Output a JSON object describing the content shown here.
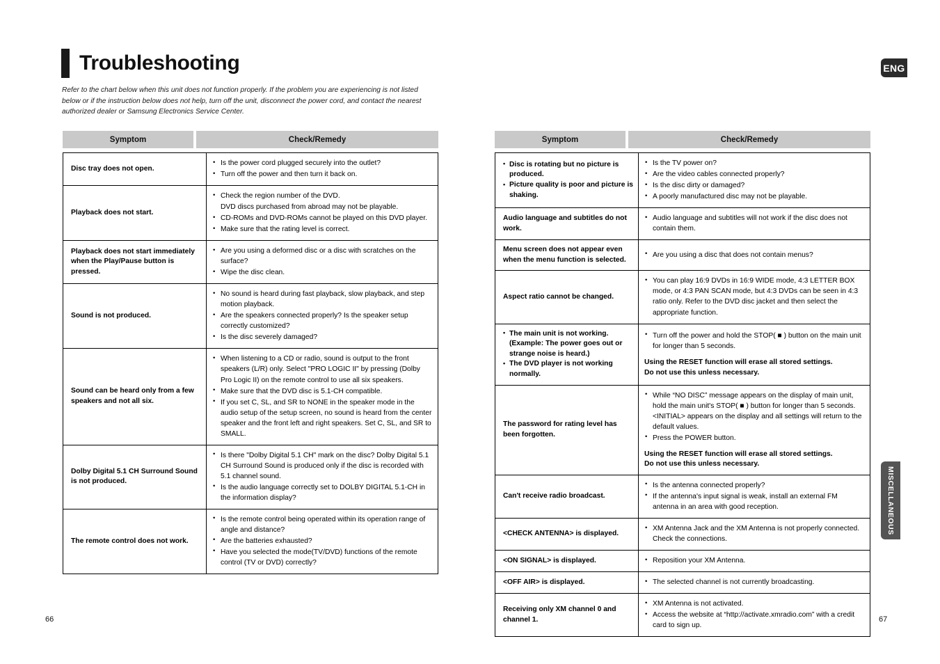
{
  "document": {
    "title": "Troubleshooting",
    "intro": "Refer to the chart below when this unit does not function properly. If the problem you are experiencing is not listed below or if the instruction below does not help, turn off the unit, disconnect the power cord, and contact the nearest authorized dealer or Samsung Electronics Service Center.",
    "language_badge": "ENG",
    "side_tab": "MISCELLANEOUS",
    "page_number_left": "66",
    "page_number_right": "67",
    "header_accent_color": "#1a1a1a",
    "table_header_bg": "#c9c9c9",
    "side_tab_bg": "#545454"
  },
  "table_headers": {
    "symptom": "Symptom",
    "remedy": "Check/Remedy"
  },
  "left_table": {
    "rows": [
      {
        "symptom": [
          "Disc tray does not open."
        ],
        "symptom_bulleted": false,
        "remedy": [
          "Is the power cord plugged securely into the outlet?",
          "Turn off the power and then turn it back on."
        ]
      },
      {
        "symptom": [
          "Playback does not start."
        ],
        "symptom_bulleted": false,
        "remedy": [
          "Check the region number of the DVD.\nDVD discs purchased from abroad may not be playable.",
          "CD-ROMs and DVD-ROMs cannot be played on this DVD player.",
          "Make sure that the rating level is correct."
        ]
      },
      {
        "symptom": [
          "Playback does not start immediately when the Play/Pause button is pressed."
        ],
        "symptom_bulleted": false,
        "remedy": [
          "Are you using a deformed disc or a disc with scratches on the surface?",
          "Wipe the disc clean."
        ]
      },
      {
        "symptom": [
          "Sound is not produced."
        ],
        "symptom_bulleted": false,
        "remedy": [
          "No sound is heard during fast playback, slow playback, and step motion playback.",
          "Are the speakers connected properly? Is the speaker setup correctly customized?",
          "Is the disc severely damaged?"
        ]
      },
      {
        "symptom": [
          "Sound can be heard only from a few speakers and not all six."
        ],
        "symptom_bulleted": false,
        "remedy": [
          "When listening to a CD or radio, sound is output to the front speakers (L/R) only. Select \"PRO LOGIC II\" by pressing (Dolby Pro Logic II) on the remote control to use all six speakers.",
          "Make sure that the DVD disc is 5.1-CH compatible.",
          "If you set C, SL, and SR to NONE in the speaker mode in the audio setup of the setup screen, no sound is heard from the center speaker and the front left and right speakers. Set C, SL, and SR to SMALL."
        ]
      },
      {
        "symptom": [
          "Dolby Digital 5.1 CH Surround Sound is not produced."
        ],
        "symptom_bulleted": false,
        "remedy": [
          "Is there \"Dolby Digital 5.1 CH\" mark on the disc? Dolby Digital 5.1 CH Surround Sound is produced only if the disc is recorded with 5.1 channel sound.",
          "Is the audio language correctly set to DOLBY DIGITAL 5.1-CH in the information display?"
        ]
      },
      {
        "symptom": [
          "The remote control does not work."
        ],
        "symptom_bulleted": false,
        "remedy": [
          "Is the remote control being operated within its operation range of angle and distance?",
          "Are the batteries exhausted?",
          "Have you selected the mode(TV/DVD) functions of the remote control (TV or DVD) correctly?"
        ]
      }
    ]
  },
  "right_table": {
    "rows": [
      {
        "symptom": [
          "Disc is rotating but no picture is produced.",
          "Picture quality is poor and picture is shaking."
        ],
        "symptom_bulleted": true,
        "remedy": [
          "Is the TV power on?",
          "Are the video cables connected properly?",
          "Is the disc dirty or damaged?",
          "A poorly manufactured disc may not be playable."
        ]
      },
      {
        "symptom": [
          "Audio language and subtitles do not work."
        ],
        "symptom_bulleted": false,
        "remedy": [
          "Audio language and subtitles will not work if the disc does not contain them."
        ]
      },
      {
        "symptom": [
          "Menu screen does not appear even when the menu function is selected."
        ],
        "symptom_bulleted": false,
        "remedy": [
          "Are you using a disc that does not contain menus?"
        ]
      },
      {
        "symptom": [
          "Aspect ratio cannot be changed."
        ],
        "symptom_bulleted": false,
        "remedy": [
          "You can play 16:9 DVDs in 16:9 WIDE mode, 4:3 LETTER BOX mode, or 4:3 PAN SCAN mode, but 4:3 DVDs can be seen in 4:3 ratio only. Refer to the DVD disc jacket and then select the appropriate function."
        ]
      },
      {
        "symptom": [
          "The main unit is not working. (Example: The power goes out or strange noise is heard.)",
          "The DVD player is not working normally."
        ],
        "symptom_bulleted": true,
        "remedy": [
          "Turn off the power and hold the STOP( ■ ) button on the main unit for longer than 5 seconds."
        ],
        "note": "Using the RESET function will erase all stored settings.\nDo not use this unless necessary."
      },
      {
        "symptom": [
          "The password for rating level has been forgotten."
        ],
        "symptom_bulleted": false,
        "remedy": [
          "While “NO DISC” message appears on the display of main unit, hold the main unit's STOP( ■ ) button for longer than 5 seconds. <INITIAL> appears on the display and all settings will return to the default values.",
          "Press the POWER button."
        ],
        "note": "Using the RESET function will erase all stored settings.\nDo not use this unless necessary."
      },
      {
        "symptom": [
          "Can't receive radio broadcast."
        ],
        "symptom_bulleted": false,
        "remedy": [
          "Is the antenna connected properly?",
          "If the antenna's input signal is weak, install an external FM antenna in an area with good reception."
        ]
      },
      {
        "symptom": [
          "<CHECK ANTENNA> is displayed."
        ],
        "symptom_bulleted": false,
        "remedy": [
          "XM Antenna Jack and the XM Antenna is not properly connected. Check the connections."
        ]
      },
      {
        "symptom": [
          "<ON SIGNAL> is displayed."
        ],
        "symptom_bulleted": false,
        "remedy": [
          "Reposition your XM Antenna."
        ]
      },
      {
        "symptom": [
          "<OFF AIR> is displayed."
        ],
        "symptom_bulleted": false,
        "remedy": [
          "The selected channel is not currently broadcasting."
        ]
      },
      {
        "symptom": [
          "Receiving only XM channel 0 and channel 1."
        ],
        "symptom_bulleted": false,
        "remedy": [
          "XM Antenna is not activated.",
          "Access the website at “http://activate.xmradio.com” with a credit card to sign up."
        ]
      }
    ]
  }
}
